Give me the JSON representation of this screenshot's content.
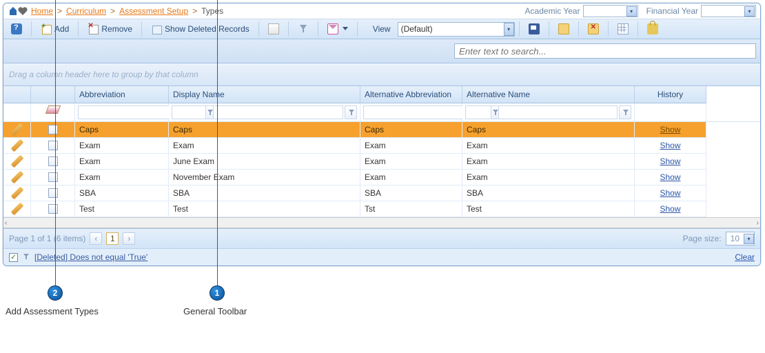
{
  "breadcrumb": {
    "home": "Home",
    "curriculum": "Curriculum",
    "assessment_setup": "Assessment Setup",
    "types": "Types",
    "sep": ">"
  },
  "top_selectors": {
    "academic_label": "Academic Year",
    "financial_label": "Financial Year"
  },
  "toolbar": {
    "add": "Add",
    "remove": "Remove",
    "show_deleted": "Show Deleted Records",
    "view_label": "View",
    "view_value": "(Default)"
  },
  "search": {
    "placeholder": "Enter text to search..."
  },
  "group_hint": "Drag a column header here to group by that column",
  "columns": {
    "abbrev": "Abbreviation",
    "display_name": "Display Name",
    "alt_abbrev": "Alternative Abbreviation",
    "alt_name": "Alternative Name",
    "history": "History"
  },
  "history_link": "Show",
  "rows": [
    {
      "abbrev": "Caps",
      "display_name": "Caps",
      "alt_abbrev": "Caps",
      "alt_name": "Caps",
      "selected": true
    },
    {
      "abbrev": "Exam",
      "display_name": "Exam",
      "alt_abbrev": "Exam",
      "alt_name": "Exam",
      "selected": false
    },
    {
      "abbrev": "Exam",
      "display_name": "June Exam",
      "alt_abbrev": "Exam",
      "alt_name": "Exam",
      "selected": false
    },
    {
      "abbrev": "Exam",
      "display_name": "November Exam",
      "alt_abbrev": "Exam",
      "alt_name": "Exam",
      "selected": false
    },
    {
      "abbrev": "SBA",
      "display_name": "SBA",
      "alt_abbrev": "SBA",
      "alt_name": "SBA",
      "selected": false
    },
    {
      "abbrev": "Test",
      "display_name": "Test",
      "alt_abbrev": "Tst",
      "alt_name": "Test",
      "selected": false
    }
  ],
  "pager": {
    "summary": "Page 1 of 1 (6 items)",
    "current_page": "1",
    "size_label": "Page size:",
    "size_value": "10"
  },
  "filter_summary": {
    "expr": "[Deleted] Does not equal 'True'",
    "clear": "Clear"
  },
  "annotations": {
    "n1": "1",
    "n2": "2",
    "label1": "General Toolbar",
    "label2": "Add Assessment Types"
  }
}
